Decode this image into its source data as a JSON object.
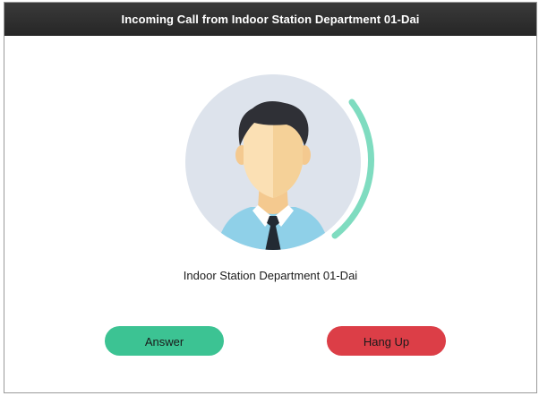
{
  "window": {
    "title": "Incoming Call from Indoor Station Department 01-Dai"
  },
  "caller": {
    "name": "Indoor Station Department 01-Dai",
    "avatar_icon": "person-avatar-icon"
  },
  "actions": {
    "answer_label": "Answer",
    "hangup_label": "Hang Up"
  },
  "colors": {
    "titlebar": "#2f2f2f",
    "answer": "#3cc393",
    "hangup": "#dc3e47",
    "ring_progress": "#7fdcc0",
    "avatar_bg": "#dde3ec"
  }
}
